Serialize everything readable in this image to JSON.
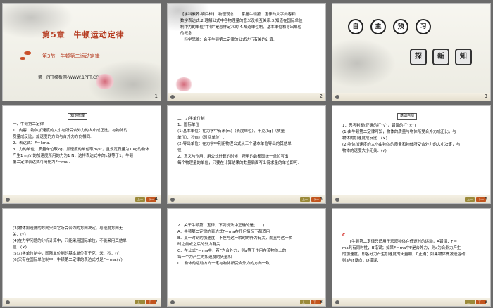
{
  "slides": [
    {
      "id": 1,
      "title": "第5章　牛顿运动定律",
      "subtitle": "第3节　牛顿第二运动定律",
      "source": "第一PPT模板网-WWW.1PPT.COM",
      "num": "1"
    },
    {
      "id": 2,
      "lines": [
        "【学科素养·明目标】　物理观念：1.掌握牛顿第二定律的文字内容和",
        "数学表达式.2.理解公式中各物理量的意义及相互关系.3.知道在国际单位",
        "制中力的单位“牛顿”是怎样定义的.4.知道单位制、基本单位和导出单位",
        "的概念.",
        "　科学思维：会用牛顿第二定律的公式进行有关的计算."
      ],
      "num": "2"
    },
    {
      "id": 3,
      "seals_top": [
        "自",
        "主",
        "预",
        "习"
      ],
      "seals_bottom": [
        "探",
        "新",
        "知"
      ],
      "num": "3"
    },
    {
      "id": 4,
      "label": "知识梳理",
      "lines": [
        "一、牛顿第二定律",
        "1．内容：物体加速度的大小与所受合外力的大小成正比，与物体的",
        "质量成反比，加速度的方向与合外力方向相同.",
        "2．表达式：F＝kma.",
        "3．力的单位：质量单位取kg，加速度的单位取m/s²，且规定质量为1 kg的物体",
        "产生1 m/s²的加速度所用的力为1 N，这样表达式中的k就等于1，牛顿",
        "第二定律表达式可简化为F＝ma ."
      ],
      "num": "4"
    },
    {
      "id": 5,
      "lines": [
        "二、力学单位制",
        "1．国际单位",
        "(1)基本单位：在力学中有米(m)（长度单位）、千克(kg)（质量",
        "单位）、秒(s)（时间单位）.",
        "(2)导出单位：在力学中利用物理公式从三个基本单位导出的其他单",
        "位.",
        "2．意义与作用：用公式计算的时候，所用的数都取统一单位写出",
        "每个物理量的单位，只要在计算结果的数量后面写出待求量的单位即可."
      ],
      "num": "5"
    },
    {
      "id": 6,
      "label": "基础自测",
      "lines": [
        "1．思考判断(正确的打“√”，错误的打“×”)",
        "(1)由牛顿第二定律可知，物体的质量与物体所受合外力成正比，与",
        "物体的加速度成反比．(×)",
        "(2)物体加速度的大小由物体的质量和物体所受合外力的大小决定，与",
        "物体的速度大小无关．(√)"
      ],
      "num": "6"
    },
    {
      "id": 7,
      "lines": [
        "(3)物体加速度的方向只由它所受合力的方向决定，与速度方向无",
        "关．(√)",
        "(4)在力学问题的分析计算中，只能采用国际单位，不能采用其他单",
        "位．(×)",
        "(5)力学单位制中，国际单位制的基本单位有千克、米、秒．(√)",
        "(6)只有在国际单位制中，牛顿第二定律的表达式才是F＝ma.(√)"
      ],
      "num": "7"
    },
    {
      "id": 8,
      "lines": [
        "2．关于牛顿第二定律，下列说法中正确的是(　　)",
        "A．牛顿第二定律的表达式F＝ma在任何情况下都适用",
        "B．某一时刻的加速度，不但与这一瞬时的外力有关，而且与这一瞬",
        "时之前或之后的外力有关",
        "C．在公式F＝ma中，若F为合外力，则a等于作用在该物体上的",
        "每一个力产生的加速度的矢量和",
        "D．物体的运动方向一定与物体所受合外力的方向一致"
      ],
      "num": "8"
    },
    {
      "id": 9,
      "answer": "C",
      "lines": [
        "　　[牛顿第二定律只适用于宏观物体在低速时的运动，A错误；F＝",
        "ma具有同时性，B错误；如果F＝ma中F是合外力，则a为合外力产生",
        "的加速度，即各分力产生加速度的矢量和，C正确；如果物体做减速运动，",
        "则a与F反向，D错误．]"
      ],
      "num": "9"
    }
  ],
  "footer": {
    "btn_prev": "上一页",
    "btn_next": "下一页"
  },
  "colors": {
    "accent": "#d0201a",
    "title": "#b53a1f",
    "background": "#6b6b6b"
  }
}
